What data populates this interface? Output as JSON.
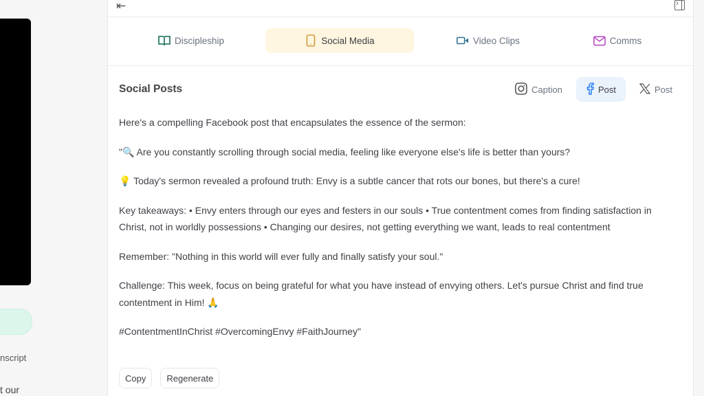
{
  "left_panel": {
    "transcript_label": "nscript",
    "partial_text": "t our"
  },
  "tabs": [
    {
      "label": "Discipleship",
      "icon": "book-icon",
      "color": "#2e7d6b",
      "active": false
    },
    {
      "label": "Social Media",
      "icon": "phone-icon",
      "color": "#d29a3c",
      "active": true
    },
    {
      "label": "Video Clips",
      "icon": "video-icon",
      "color": "#2f6f8f",
      "active": false
    },
    {
      "label": "Comms",
      "icon": "mail-icon",
      "color": "#b84fc6",
      "active": false
    }
  ],
  "section": {
    "title": "Social Posts",
    "platforms": [
      {
        "label": "Caption",
        "icon": "instagram-icon",
        "active": false
      },
      {
        "label": "Post",
        "icon": "facebook-icon",
        "active": true
      },
      {
        "label": "Post",
        "icon": "x-icon",
        "active": false
      }
    ]
  },
  "post": {
    "intro": "Here's a compelling Facebook post that encapsulates the essence of the sermon:",
    "line1": "\"🔍 Are you constantly scrolling through social media, feeling like everyone else's life is better than yours?",
    "line2": "💡 Today's sermon revealed a profound truth: Envy is a subtle cancer that rots our bones, but there's a cure!",
    "takeaways": "Key takeaways: • Envy enters through our eyes and festers in our souls • True contentment comes from finding satisfaction in Christ, not in worldly possessions • Changing our desires, not getting everything we want, leads to real contentment",
    "remember": "Remember: \"Nothing in this world will ever fully and finally satisfy your soul.\"",
    "challenge": "Challenge: This week, focus on being grateful for what you have instead of envying others. Let's pursue Christ and find true contentment in Him! 🙏",
    "hashtags": "#ContentmentInChrist #OvercomingEnvy #FaithJourney\""
  },
  "actions": {
    "copy": "Copy",
    "regenerate": "Regenerate"
  },
  "colors": {
    "active_tab_bg": "#fef6e0",
    "active_platform_bg": "#eaf2fc",
    "facebook": "#1877f2"
  }
}
